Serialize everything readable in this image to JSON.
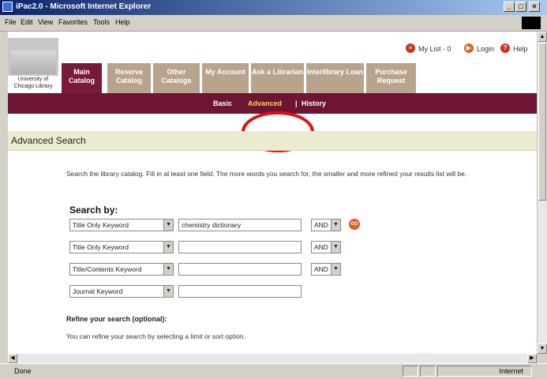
{
  "window": {
    "title": "iPac2.0 - Microsoft Internet Explorer",
    "min": "_",
    "max": "□",
    "close": "×"
  },
  "menu": [
    "File",
    "Edit",
    "View",
    "Favorites",
    "Tools",
    "Help"
  ],
  "header": {
    "university": "University of Chicago Library",
    "links": [
      {
        "label": "My List - 0",
        "icon": "list-icon"
      },
      {
        "label": "Login",
        "icon": "arrow-icon"
      },
      {
        "label": "Help",
        "icon": "help-icon"
      }
    ]
  },
  "tabs": [
    {
      "label": "Main Catalog",
      "active": true
    },
    {
      "label": "Reserve Catalog"
    },
    {
      "label": "Other Catalogs"
    },
    {
      "label": "My Account"
    },
    {
      "label": "Ask a Librarian"
    },
    {
      "label": "Interlibrary Loan"
    },
    {
      "label": "Purchase Request"
    }
  ],
  "subnav": {
    "basic": "Basic",
    "advanced": "Advanced",
    "sep": "|",
    "history": "History"
  },
  "content": {
    "section_title": "Advanced Search",
    "intro": "Search the library catalog. Fill in at least one field. The more words you search for, the smaller and more refined your results list will be.",
    "search_by": "Search by:",
    "rows": [
      {
        "field": "Title Only Keyword",
        "value": "chemistry dictionary",
        "op": "AND"
      },
      {
        "field": "Title Only Keyword",
        "value": "",
        "op": "AND"
      },
      {
        "field": "Title/Contents Keyword",
        "value": "",
        "op": "AND"
      },
      {
        "field": "Journal Keyword",
        "value": ""
      }
    ],
    "go": "GO",
    "refine_title": "Refine your search (optional):",
    "refine_text": "You can refine your search by selecting a limit or sort option."
  },
  "status": {
    "text": "Done",
    "zone": "Internet"
  },
  "colors": {
    "tab": "#b8a48c",
    "tab_active": "#7a1a3a",
    "subnav": "#6e1434",
    "highlight": "#e01010"
  }
}
